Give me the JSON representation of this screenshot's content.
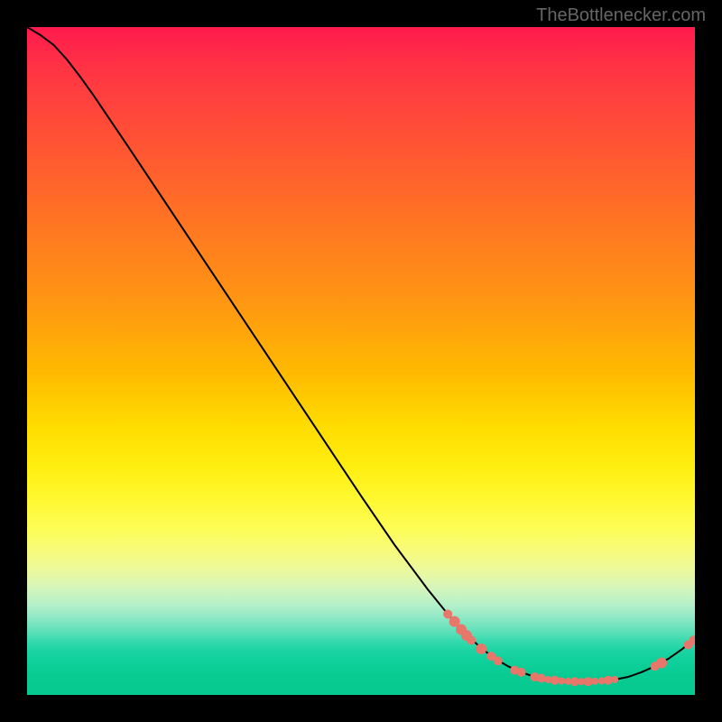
{
  "watermark": "TheBottlenecker.com",
  "chart_data": {
    "type": "line",
    "title": "",
    "xlabel": "",
    "ylabel": "",
    "xlim": [
      0,
      100
    ],
    "ylim": [
      0,
      100
    ],
    "curve": [
      {
        "x": 0.0,
        "y": 100.0
      },
      {
        "x": 2.0,
        "y": 98.8
      },
      {
        "x": 4.0,
        "y": 97.3
      },
      {
        "x": 6.0,
        "y": 95.1
      },
      {
        "x": 8.0,
        "y": 92.5
      },
      {
        "x": 10.0,
        "y": 89.7
      },
      {
        "x": 15.0,
        "y": 82.3
      },
      {
        "x": 20.0,
        "y": 74.8
      },
      {
        "x": 25.0,
        "y": 67.3
      },
      {
        "x": 30.0,
        "y": 59.8
      },
      {
        "x": 35.0,
        "y": 52.3
      },
      {
        "x": 40.0,
        "y": 44.8
      },
      {
        "x": 45.0,
        "y": 37.3
      },
      {
        "x": 50.0,
        "y": 29.8
      },
      {
        "x": 55.0,
        "y": 22.5
      },
      {
        "x": 60.0,
        "y": 15.8
      },
      {
        "x": 63.0,
        "y": 12.1
      },
      {
        "x": 65.0,
        "y": 9.8
      },
      {
        "x": 68.0,
        "y": 7.0
      },
      {
        "x": 70.0,
        "y": 5.5
      },
      {
        "x": 72.0,
        "y": 4.3
      },
      {
        "x": 74.0,
        "y": 3.4
      },
      {
        "x": 76.0,
        "y": 2.7
      },
      {
        "x": 78.0,
        "y": 2.3
      },
      {
        "x": 80.0,
        "y": 2.1
      },
      {
        "x": 82.0,
        "y": 2.0
      },
      {
        "x": 84.0,
        "y": 2.0
      },
      {
        "x": 86.0,
        "y": 2.1
      },
      {
        "x": 88.0,
        "y": 2.3
      },
      {
        "x": 90.0,
        "y": 2.7
      },
      {
        "x": 92.0,
        "y": 3.4
      },
      {
        "x": 94.0,
        "y": 4.3
      },
      {
        "x": 96.0,
        "y": 5.4
      },
      {
        "x": 98.0,
        "y": 6.8
      },
      {
        "x": 100.0,
        "y": 8.4
      }
    ],
    "scatter_points": [
      {
        "x": 63.0,
        "y": 12.1,
        "r": 5
      },
      {
        "x": 64.0,
        "y": 11.0,
        "r": 6
      },
      {
        "x": 65.0,
        "y": 9.8,
        "r": 6
      },
      {
        "x": 65.8,
        "y": 8.9,
        "r": 6
      },
      {
        "x": 66.5,
        "y": 8.2,
        "r": 5
      },
      {
        "x": 68.0,
        "y": 6.9,
        "r": 6
      },
      {
        "x": 69.5,
        "y": 5.8,
        "r": 5
      },
      {
        "x": 70.5,
        "y": 5.1,
        "r": 5
      },
      {
        "x": 73.0,
        "y": 3.7,
        "r": 5
      },
      {
        "x": 74.0,
        "y": 3.4,
        "r": 5
      },
      {
        "x": 76.0,
        "y": 2.7,
        "r": 5
      },
      {
        "x": 77.0,
        "y": 2.5,
        "r": 5
      },
      {
        "x": 78.0,
        "y": 2.3,
        "r": 4
      },
      {
        "x": 79.0,
        "y": 2.2,
        "r": 5
      },
      {
        "x": 80.0,
        "y": 2.1,
        "r": 4
      },
      {
        "x": 81.0,
        "y": 2.05,
        "r": 4
      },
      {
        "x": 82.0,
        "y": 2.0,
        "r": 5
      },
      {
        "x": 83.0,
        "y": 2.0,
        "r": 4
      },
      {
        "x": 84.0,
        "y": 2.0,
        "r": 5
      },
      {
        "x": 85.0,
        "y": 2.05,
        "r": 4
      },
      {
        "x": 86.0,
        "y": 2.1,
        "r": 4
      },
      {
        "x": 87.0,
        "y": 2.2,
        "r": 5
      },
      {
        "x": 88.0,
        "y": 2.3,
        "r": 4
      },
      {
        "x": 94.0,
        "y": 4.3,
        "r": 5
      },
      {
        "x": 95.0,
        "y": 4.8,
        "r": 6
      },
      {
        "x": 99.0,
        "y": 7.5,
        "r": 5
      },
      {
        "x": 99.8,
        "y": 8.2,
        "r": 5
      }
    ],
    "scatter_color": "#e8776b",
    "line_color": "#000000"
  }
}
